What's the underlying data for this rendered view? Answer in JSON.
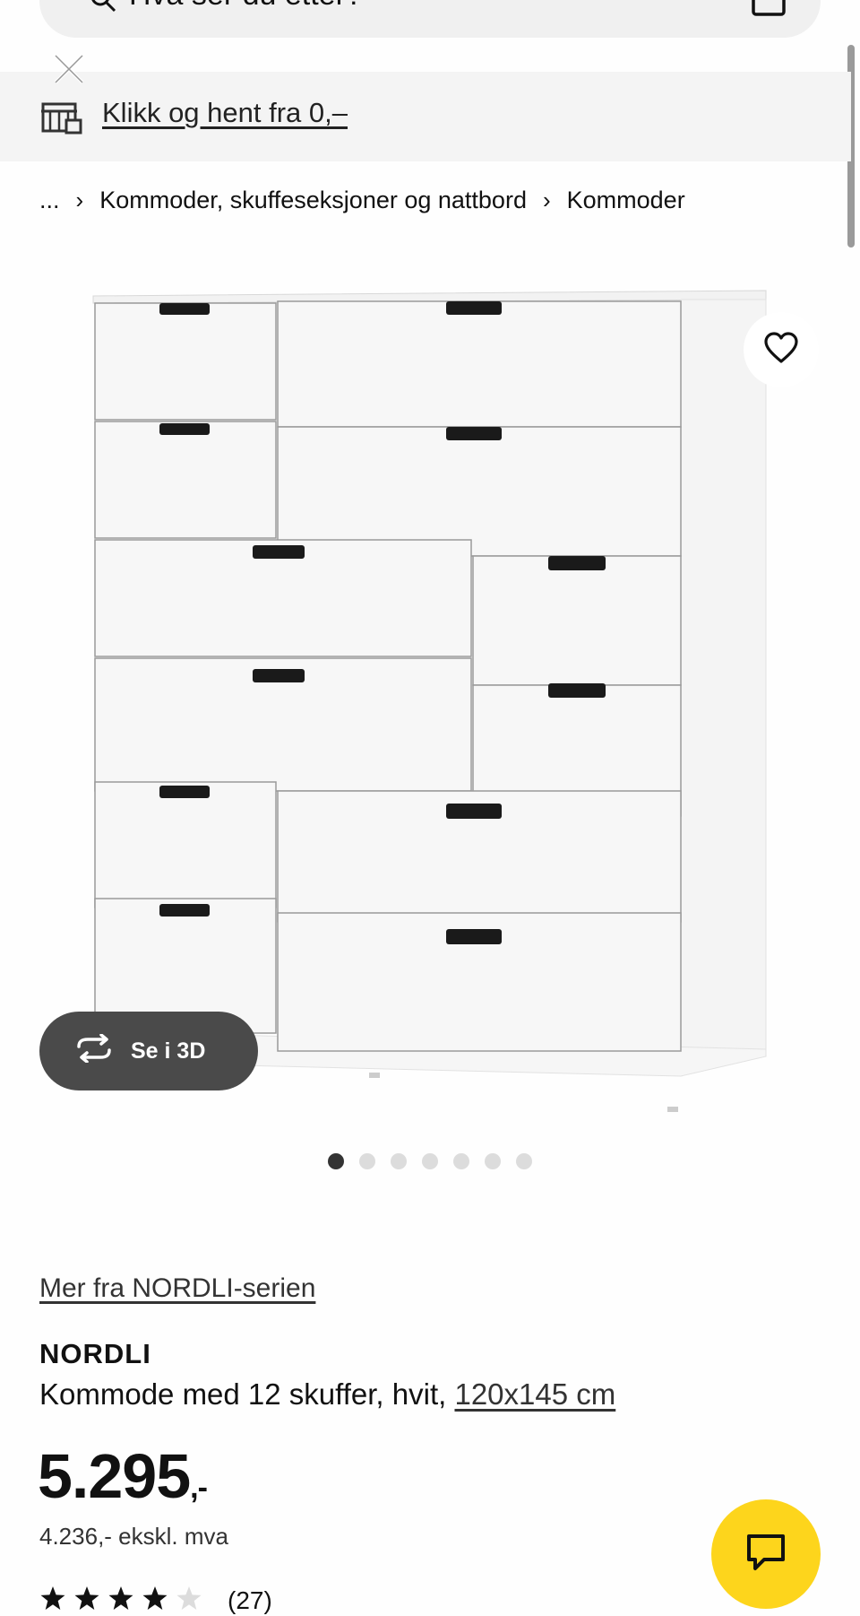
{
  "search": {
    "placeholder": "Hva ser du etter?"
  },
  "banner": {
    "link_text": "Klikk og hent fra 0,–"
  },
  "breadcrumb": {
    "ellipsis": "...",
    "items": [
      "Kommoder, skuffeseksjoner og nattbord",
      "Kommoder"
    ]
  },
  "gallery": {
    "view_3d_label": "Se i 3D",
    "image_count": 7,
    "active_index": 0
  },
  "product": {
    "series_link": "Mer fra NORDLI-serien",
    "name": "NORDLI",
    "description": "Kommode med 12 skuffer, hvit,",
    "size": "120x145 cm",
    "price": "5.295",
    "price_suffix": ",-",
    "price_excl_vat": "4.236,- ekskl. mva",
    "rating": 4,
    "rating_max": 5,
    "review_count": "(27)"
  },
  "colors": {
    "chat_button": "#fdd51c",
    "view_3d_button": "#4a4a4a"
  }
}
